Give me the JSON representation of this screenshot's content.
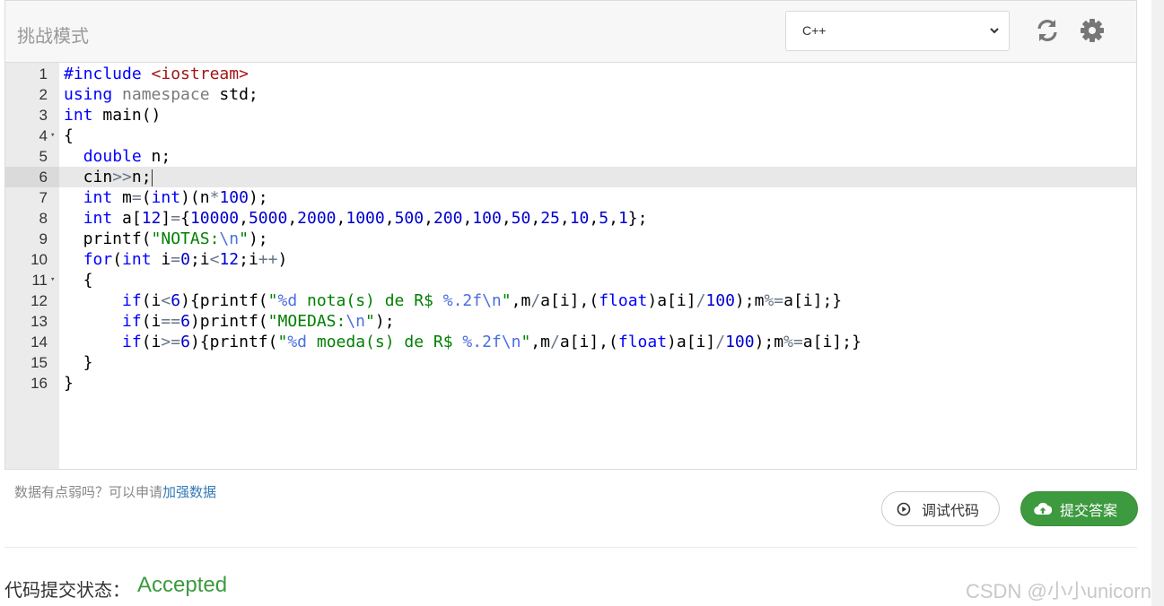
{
  "toolbar": {
    "mode_title": "挑战模式",
    "language_selected": "C++",
    "refresh_icon": "refresh-icon",
    "settings_icon": "gear-icon"
  },
  "editor": {
    "active_line": 6,
    "lines": [
      {
        "n": "1",
        "fold": false,
        "tokens": [
          {
            "t": "#include ",
            "c": "inc"
          },
          {
            "t": "<iostream>",
            "c": "ang"
          }
        ]
      },
      {
        "n": "2",
        "fold": false,
        "tokens": [
          {
            "t": "using",
            "c": "kw"
          },
          {
            "t": " "
          },
          {
            "t": "namespace",
            "c": "kw2"
          },
          {
            "t": " std;"
          }
        ]
      },
      {
        "n": "3",
        "fold": false,
        "tokens": [
          {
            "t": "int",
            "c": "kw"
          },
          {
            "t": " main()"
          }
        ]
      },
      {
        "n": "4",
        "fold": true,
        "tokens": [
          {
            "t": "{"
          }
        ]
      },
      {
        "n": "5",
        "fold": false,
        "tokens": [
          {
            "t": "  "
          },
          {
            "t": "double",
            "c": "kw"
          },
          {
            "t": " n;"
          }
        ]
      },
      {
        "n": "6",
        "fold": false,
        "tokens": [
          {
            "t": "  cin"
          },
          {
            "t": ">>",
            "c": "op"
          },
          {
            "t": "n;"
          }
        ],
        "cursor": true
      },
      {
        "n": "7",
        "fold": false,
        "tokens": [
          {
            "t": "  "
          },
          {
            "t": "int",
            "c": "kw"
          },
          {
            "t": " m"
          },
          {
            "t": "=",
            "c": "op"
          },
          {
            "t": "("
          },
          {
            "t": "int",
            "c": "kw"
          },
          {
            "t": ")(n"
          },
          {
            "t": "*",
            "c": "op"
          },
          {
            "t": "100",
            "c": "num"
          },
          {
            "t": ");"
          }
        ]
      },
      {
        "n": "8",
        "fold": false,
        "tokens": [
          {
            "t": "  "
          },
          {
            "t": "int",
            "c": "kw"
          },
          {
            "t": " a["
          },
          {
            "t": "12",
            "c": "num"
          },
          {
            "t": "]"
          },
          {
            "t": "=",
            "c": "op"
          },
          {
            "t": "{"
          },
          {
            "t": "10000",
            "c": "num"
          },
          {
            "t": ","
          },
          {
            "t": "5000",
            "c": "num"
          },
          {
            "t": ","
          },
          {
            "t": "2000",
            "c": "num"
          },
          {
            "t": ","
          },
          {
            "t": "1000",
            "c": "num"
          },
          {
            "t": ","
          },
          {
            "t": "500",
            "c": "num"
          },
          {
            "t": ","
          },
          {
            "t": "200",
            "c": "num"
          },
          {
            "t": ","
          },
          {
            "t": "100",
            "c": "num"
          },
          {
            "t": ","
          },
          {
            "t": "50",
            "c": "num"
          },
          {
            "t": ","
          },
          {
            "t": "25",
            "c": "num"
          },
          {
            "t": ","
          },
          {
            "t": "10",
            "c": "num"
          },
          {
            "t": ","
          },
          {
            "t": "5",
            "c": "num"
          },
          {
            "t": ","
          },
          {
            "t": "1",
            "c": "num"
          },
          {
            "t": "};"
          }
        ]
      },
      {
        "n": "9",
        "fold": false,
        "tokens": [
          {
            "t": "  printf("
          },
          {
            "t": "\"NOTAS:",
            "c": "str"
          },
          {
            "t": "\\n",
            "c": "esc"
          },
          {
            "t": "\"",
            "c": "str"
          },
          {
            "t": ");"
          }
        ]
      },
      {
        "n": "10",
        "fold": false,
        "tokens": [
          {
            "t": "  "
          },
          {
            "t": "for",
            "c": "kw"
          },
          {
            "t": "("
          },
          {
            "t": "int",
            "c": "kw"
          },
          {
            "t": " i"
          },
          {
            "t": "=",
            "c": "op"
          },
          {
            "t": "0",
            "c": "num"
          },
          {
            "t": ";i"
          },
          {
            "t": "<",
            "c": "op"
          },
          {
            "t": "12",
            "c": "num"
          },
          {
            "t": ";i"
          },
          {
            "t": "++",
            "c": "op"
          },
          {
            "t": ")"
          }
        ]
      },
      {
        "n": "11",
        "fold": true,
        "tokens": [
          {
            "t": "  {"
          }
        ]
      },
      {
        "n": "12",
        "fold": false,
        "tokens": [
          {
            "t": "      "
          },
          {
            "t": "if",
            "c": "kw"
          },
          {
            "t": "(i"
          },
          {
            "t": "<",
            "c": "op"
          },
          {
            "t": "6",
            "c": "num"
          },
          {
            "t": "){printf("
          },
          {
            "t": "\"",
            "c": "str"
          },
          {
            "t": "%d",
            "c": "esc"
          },
          {
            "t": " nota(s) de R$ ",
            "c": "str"
          },
          {
            "t": "%.2f",
            "c": "esc"
          },
          {
            "t": "\\n",
            "c": "esc"
          },
          {
            "t": "\"",
            "c": "str"
          },
          {
            "t": ",m"
          },
          {
            "t": "/",
            "c": "op"
          },
          {
            "t": "a[i],("
          },
          {
            "t": "float",
            "c": "kw"
          },
          {
            "t": ")a[i]"
          },
          {
            "t": "/",
            "c": "op"
          },
          {
            "t": "100",
            "c": "num"
          },
          {
            "t": ");m"
          },
          {
            "t": "%=",
            "c": "op"
          },
          {
            "t": "a[i];}"
          }
        ]
      },
      {
        "n": "13",
        "fold": false,
        "tokens": [
          {
            "t": "      "
          },
          {
            "t": "if",
            "c": "kw"
          },
          {
            "t": "(i"
          },
          {
            "t": "==",
            "c": "op"
          },
          {
            "t": "6",
            "c": "num"
          },
          {
            "t": ")printf("
          },
          {
            "t": "\"MOEDAS:",
            "c": "str"
          },
          {
            "t": "\\n",
            "c": "esc"
          },
          {
            "t": "\"",
            "c": "str"
          },
          {
            "t": ");"
          }
        ]
      },
      {
        "n": "14",
        "fold": false,
        "tokens": [
          {
            "t": "      "
          },
          {
            "t": "if",
            "c": "kw"
          },
          {
            "t": "(i"
          },
          {
            "t": ">=",
            "c": "op"
          },
          {
            "t": "6",
            "c": "num"
          },
          {
            "t": "){printf("
          },
          {
            "t": "\"",
            "c": "str"
          },
          {
            "t": "%d",
            "c": "esc"
          },
          {
            "t": " moeda(s) de R$ ",
            "c": "str"
          },
          {
            "t": "%.2f",
            "c": "esc"
          },
          {
            "t": "\\n",
            "c": "esc"
          },
          {
            "t": "\"",
            "c": "str"
          },
          {
            "t": ",m"
          },
          {
            "t": "/",
            "c": "op"
          },
          {
            "t": "a[i],("
          },
          {
            "t": "float",
            "c": "kw"
          },
          {
            "t": ")a[i]"
          },
          {
            "t": "/",
            "c": "op"
          },
          {
            "t": "100",
            "c": "num"
          },
          {
            "t": ");m"
          },
          {
            "t": "%=",
            "c": "op"
          },
          {
            "t": "a[i];}"
          }
        ]
      },
      {
        "n": "15",
        "fold": false,
        "tokens": [
          {
            "t": "  }"
          }
        ]
      },
      {
        "n": "16",
        "fold": false,
        "tokens": [
          {
            "t": "}"
          }
        ]
      }
    ]
  },
  "footer": {
    "hint_text": "数据有点弱吗？可以申请",
    "hint_link": "加强数据",
    "debug_label": "调试代码",
    "submit_label": "提交答案",
    "status_label": "代码提交状态：",
    "status_value": "Accepted",
    "watermark": "CSDN @小小unicorn"
  },
  "colors": {
    "accent_green": "#3d9a3f",
    "keyword_blue": "#0000ff",
    "string_green": "#008000"
  }
}
